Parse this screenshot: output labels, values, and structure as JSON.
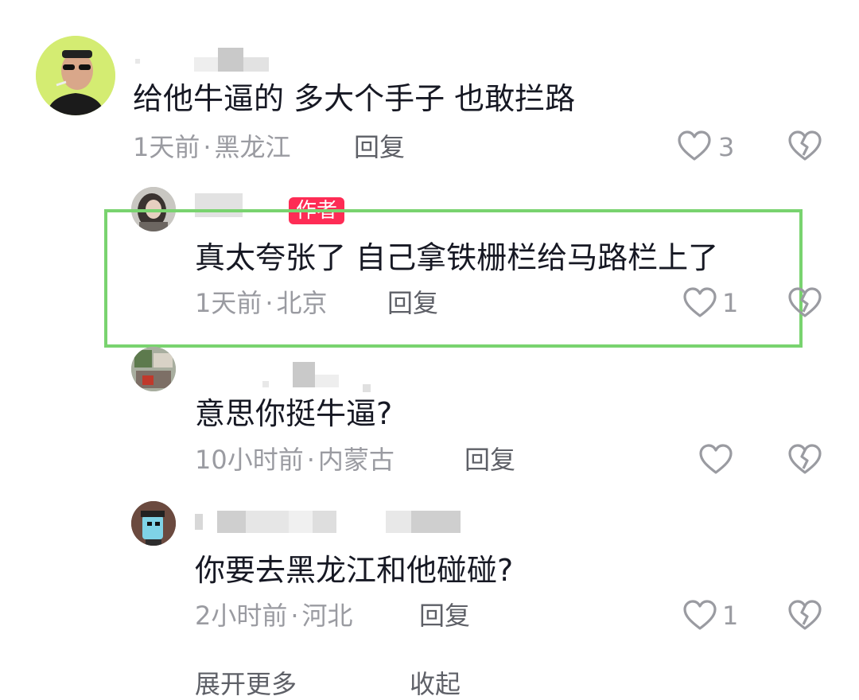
{
  "comments": [
    {
      "text": "给他牛逼的 多大个手子 也敢拦路",
      "time": "1天前",
      "location": "黑龙江",
      "reply_label": "回复",
      "likes": "3",
      "like_icon": "heart-outline-icon",
      "dislike_icon": "broken-heart-icon"
    },
    {
      "badge": "作者",
      "text": "真太夸张了 自己拿铁栅栏给马路栏上了",
      "time": "1天前",
      "location": "北京",
      "reply_label": "回复",
      "likes": "1",
      "like_icon": "heart-outline-icon",
      "dislike_icon": "broken-heart-icon"
    },
    {
      "text": "意思你挺牛逼?",
      "time": "10小时前",
      "location": "内蒙古",
      "reply_label": "回复",
      "likes": "",
      "like_icon": "heart-outline-icon",
      "dislike_icon": "broken-heart-icon"
    },
    {
      "text": "你要去黑龙江和他碰碰?",
      "time": "2小时前",
      "location": "河北",
      "reply_label": "回复",
      "likes": "1",
      "like_icon": "heart-outline-icon",
      "dislike_icon": "broken-heart-icon"
    }
  ],
  "meta_separator": "·",
  "footer": {
    "expand_label": "展开更多",
    "collapse_label": "收起"
  },
  "colors": {
    "highlight_border": "#79d36f",
    "author_badge": "#fe2c55",
    "text_primary": "#161823",
    "text_secondary": "#9a9ba1"
  }
}
